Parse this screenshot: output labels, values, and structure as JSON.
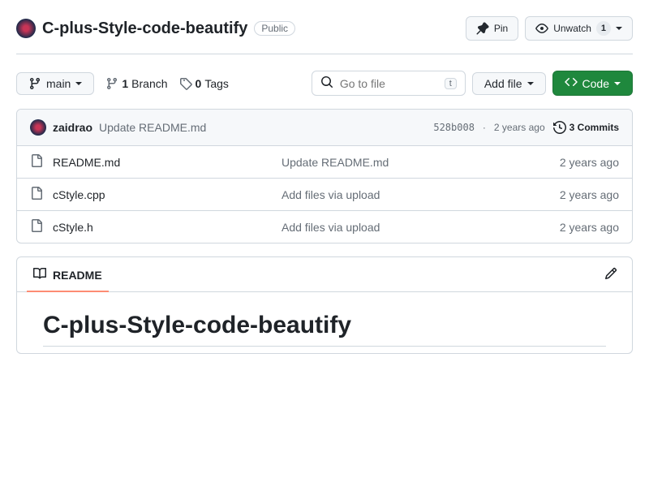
{
  "header": {
    "repo_name": "C-plus-Style-code-beautify",
    "visibility": "Public",
    "pin_label": "Pin",
    "watch_label": "Unwatch",
    "watch_count": "1"
  },
  "toolbar": {
    "branch": "main",
    "branches_count": "1",
    "branches_label": "Branch",
    "tags_count": "0",
    "tags_label": "Tags",
    "search_placeholder": "Go to file",
    "search_kbd": "t",
    "add_file_label": "Add file",
    "code_label": "Code"
  },
  "commit_bar": {
    "author": "zaidrao",
    "message": "Update README.md",
    "hash": "528b008",
    "time": "2 years ago",
    "commits_count": "3 Commits"
  },
  "files": [
    {
      "name": "README.md",
      "msg": "Update README.md",
      "time": "2 years ago"
    },
    {
      "name": "cStyle.cpp",
      "msg": "Add files via upload",
      "time": "2 years ago"
    },
    {
      "name": "cStyle.h",
      "msg": "Add files via upload",
      "time": "2 years ago"
    }
  ],
  "readme": {
    "tab_label": "README",
    "heading": "C-plus-Style-code-beautify"
  }
}
